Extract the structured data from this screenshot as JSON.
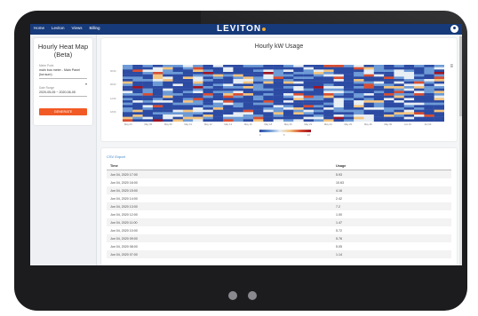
{
  "nav": {
    "items": [
      "Home",
      "Leviton",
      "Views",
      "Billing"
    ]
  },
  "brand": {
    "name": "LEVITON"
  },
  "sidebar": {
    "title": "Hourly Heat Map (Beta)",
    "meter_label": "Meter Point",
    "meter_value": "main bus meter - Main Panel (kw:sum)",
    "date_label": "Date Range",
    "date_value": "2020-05-05 ~ 2020-06-05",
    "generate_label": "GENERATE"
  },
  "chart_data": {
    "type": "heatmap",
    "title": "Hourly kW Usage",
    "x_ticks": [
      "May 04",
      "May 06",
      "May 08",
      "May 10",
      "May 12",
      "May 14",
      "May 16",
      "May 18",
      "May 20",
      "May 22",
      "May 24",
      "May 26",
      "May 28",
      "May 30",
      "Jun 01",
      "Jun 03"
    ],
    "y_ticks": [
      "00:00",
      "06:00",
      "12:00",
      "18:00"
    ],
    "colorscale": [
      "#2c4ba3",
      "#6c9ad6",
      "#e7eef4",
      "#f3c47f",
      "#d84e33",
      "#9e1424"
    ],
    "legend_ticks": [
      "0",
      "5",
      "10"
    ],
    "days": 32,
    "hours": 24,
    "seed": 7
  },
  "table": {
    "csv_label": "CSV Export",
    "headers": [
      "Time",
      "Usage"
    ],
    "rows": [
      [
        "Jun 04, 2020 17:00",
        "5.93"
      ],
      [
        "Jun 04, 2020 16:00",
        "10.63"
      ],
      [
        "Jun 04, 2020 15:00",
        "4.16"
      ],
      [
        "Jun 04, 2020 14:00",
        "2.42"
      ],
      [
        "Jun 04, 2020 13:00",
        "7.2"
      ],
      [
        "Jun 04, 2020 12:00",
        "1.00"
      ],
      [
        "Jun 04, 2020 11:00",
        "1.47"
      ],
      [
        "Jun 04, 2020 10:00",
        "5.72"
      ],
      [
        "Jun 04, 2020 09:00",
        "5.76"
      ],
      [
        "Jun 04, 2020 08:00",
        "5.05"
      ],
      [
        "Jun 04, 2020 07:00",
        "1.14"
      ]
    ]
  }
}
